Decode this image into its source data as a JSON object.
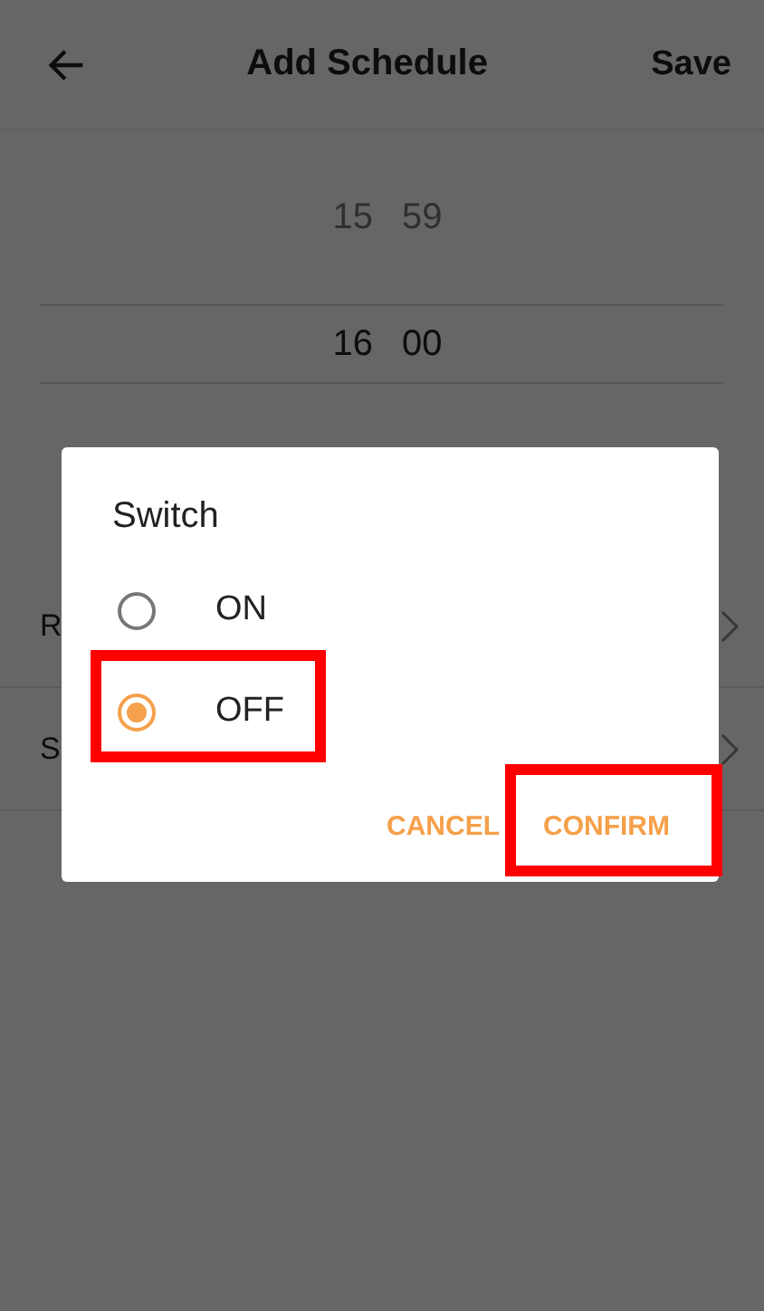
{
  "header": {
    "title": "Add Schedule",
    "action": "Save"
  },
  "time_picker": {
    "rows": [
      {
        "hour": "15",
        "minute": "59",
        "selected": false
      },
      {
        "hour": "16",
        "minute": "00",
        "selected": true
      }
    ]
  },
  "settings_rows": [
    {
      "label": "R"
    },
    {
      "label": "S"
    }
  ],
  "dialog": {
    "title": "Switch",
    "options": [
      {
        "label": "ON",
        "selected": false,
        "highlighted": false
      },
      {
        "label": "OFF",
        "selected": true,
        "highlighted": true
      }
    ],
    "buttons": [
      {
        "label": "CANCEL",
        "highlighted": false
      },
      {
        "label": "CONFIRM",
        "highlighted": true
      }
    ]
  }
}
